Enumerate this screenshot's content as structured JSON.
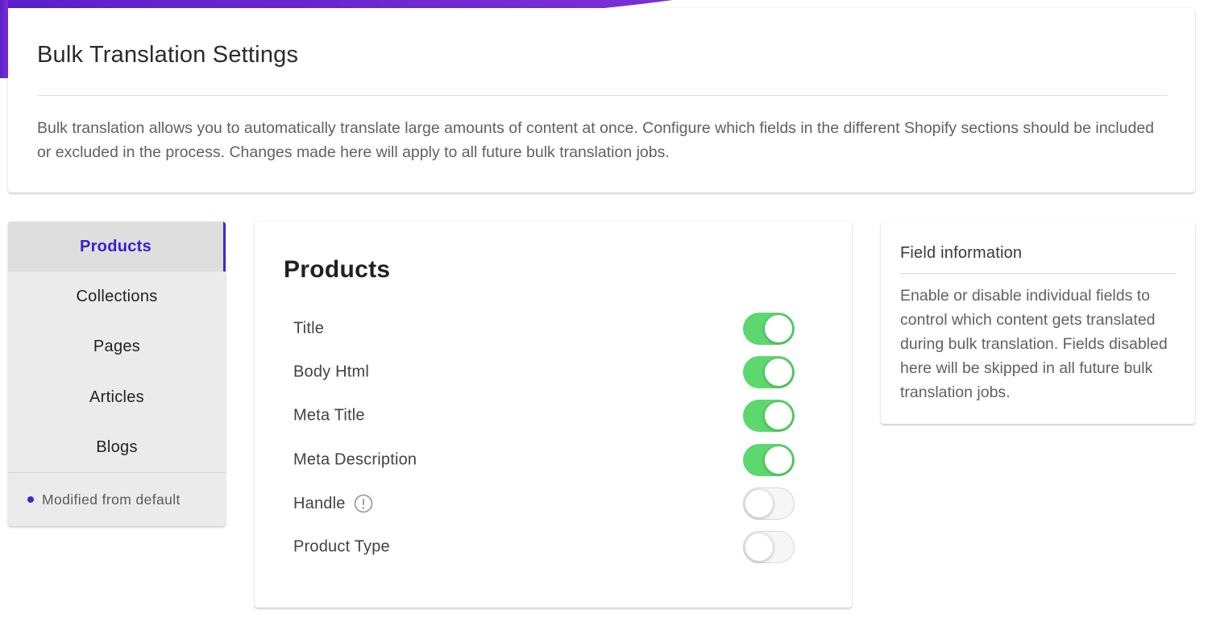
{
  "header": {
    "title": "Bulk Translation Settings",
    "description": "Bulk translation allows you to automatically translate large amounts of content at once. Configure which fields in the different Shopify sections should be included or excluded in the process. Changes made here will apply to all future bulk translation jobs."
  },
  "sidebar": {
    "items": [
      {
        "label": "Products",
        "active": true
      },
      {
        "label": "Collections",
        "active": false
      },
      {
        "label": "Pages",
        "active": false
      },
      {
        "label": "Articles",
        "active": false
      },
      {
        "label": "Blogs",
        "active": false
      }
    ],
    "legend": "Modified from default"
  },
  "main": {
    "title": "Products",
    "fields": [
      {
        "label": "Title",
        "enabled": true,
        "info_icon": false
      },
      {
        "label": "Body Html",
        "enabled": true,
        "info_icon": false
      },
      {
        "label": "Meta Title",
        "enabled": true,
        "info_icon": false
      },
      {
        "label": "Meta Description",
        "enabled": true,
        "info_icon": false
      },
      {
        "label": "Handle",
        "enabled": false,
        "info_icon": true,
        "icon": "exclamation-circle-icon"
      },
      {
        "label": "Product Type",
        "enabled": false,
        "info_icon": false
      }
    ]
  },
  "info_panel": {
    "title": "Field information",
    "text": "Enable or disable individual fields to control which content gets translated during bulk translation. Fields disabled here will be skipped in all future bulk translation jobs."
  },
  "colors": {
    "accent": "#4a26d0",
    "toggle_on": "#5cd86e",
    "gradient_start": "#6a1fd0",
    "gradient_end": "#5b2bd6"
  }
}
